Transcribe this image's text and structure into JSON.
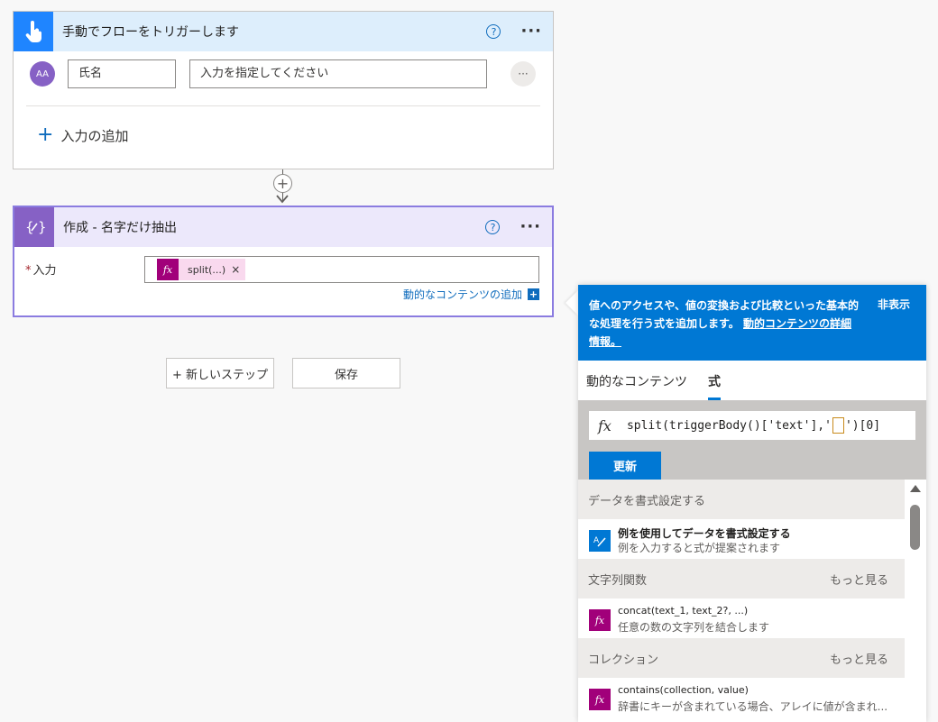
{
  "trigger": {
    "title": "手動でフローをトリガーします",
    "help": "?",
    "more": "···",
    "avatar_text": "AA",
    "name_value": "氏名",
    "prompt_value": "入力を指定してください",
    "row_more": "···",
    "add_input_label": "入力の追加"
  },
  "compose": {
    "title": "作成 - 名字だけ抽出",
    "help": "?",
    "more": "···",
    "input_label": "入力",
    "token_fx": "fx",
    "token_label": "split(...)",
    "token_remove": "×",
    "dynamic_link": "動的なコンテンツの追加"
  },
  "actions": {
    "new_step": "+ 新しいステップ",
    "save": "保存"
  },
  "panel": {
    "banner_text": "値へのアクセスや、値の変換および比較といった基本的な処理を行う式を追加します。",
    "banner_link": "動的コンテンツの詳細情報。",
    "hide": "非表示",
    "tabs": {
      "dynamic": "動的なコンテンツ",
      "expression": "式"
    },
    "expression_code_prefix": "split(triggerBody()['text'],'",
    "expression_code_suffix": "')[0]",
    "update_label": "更新",
    "sections": [
      {
        "label": "データを書式設定する",
        "more": "",
        "items": [
          {
            "name": "例を使用してデータを書式設定する",
            "desc": "例を入力すると式が提案されます"
          }
        ]
      },
      {
        "label": "文字列関数",
        "more": "もっと見る",
        "items": [
          {
            "name": "concat(text_1, text_2?, ...)",
            "desc": "任意の数の文字列を結合します"
          }
        ]
      },
      {
        "label": "コレクション",
        "more": "もっと見る",
        "items": [
          {
            "name": "contains(collection, value)",
            "desc": "辞書にキーが含まれている場合、アレイに値が含まれ..."
          }
        ]
      }
    ]
  },
  "colors": {
    "accent": "#0078d4",
    "trigger_blue": "#1f85ff",
    "compose_purple": "#8661c5",
    "fx_pink": "#a1007a"
  }
}
